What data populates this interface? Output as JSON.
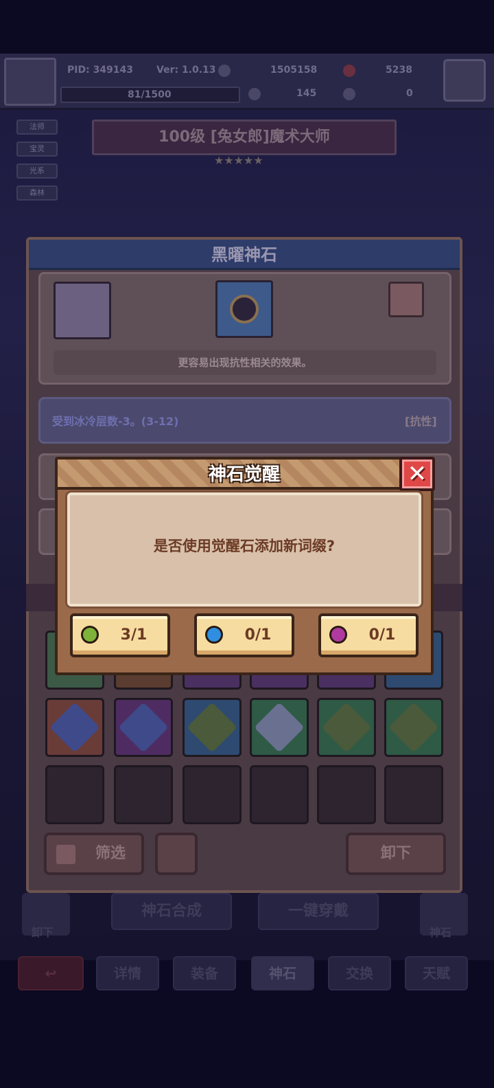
{
  "header": {
    "pid": "PID: 349143",
    "version": "Ver: 1.0.13",
    "currency_a": "1505158",
    "currency_b": "5238",
    "exp": "81/1500",
    "currency_c": "145",
    "currency_d": "0"
  },
  "side_tags": [
    "法师",
    "宝灵",
    "光系",
    "森林"
  ],
  "hero_banner": {
    "title": "100级 [兔女郎]魔术大师",
    "stars": "★★★★★"
  },
  "gem_panel": {
    "title": "黑曜神石",
    "hint": "更容易出现抗性相关的效果。",
    "affix_text": "受到冰冷层数-3。(3-12)",
    "affix_tag": "[抗性]",
    "filter_label": "筛选",
    "unequip_label": "卸下"
  },
  "bottom_actions": {
    "synth_label": "神石合成",
    "equip_all_label": "一键穿戴",
    "left_label": "卸下",
    "right_label": "神石"
  },
  "nav": {
    "tabs": [
      "详情",
      "装备",
      "神石",
      "交换",
      "天赋"
    ]
  },
  "dialog": {
    "title": "神石觉醒",
    "message": "是否使用觉醒石添加新词缀?",
    "close_icon": "close-icon",
    "options": [
      {
        "color": "#7db33a",
        "value": "3/1",
        "icon": "green-awaken-stone-icon"
      },
      {
        "color": "#2f8ee0",
        "value": "0/1",
        "icon": "blue-awaken-stone-icon"
      },
      {
        "color": "#b03aa0",
        "value": "0/1",
        "icon": "purple-awaken-stone-icon"
      }
    ]
  }
}
